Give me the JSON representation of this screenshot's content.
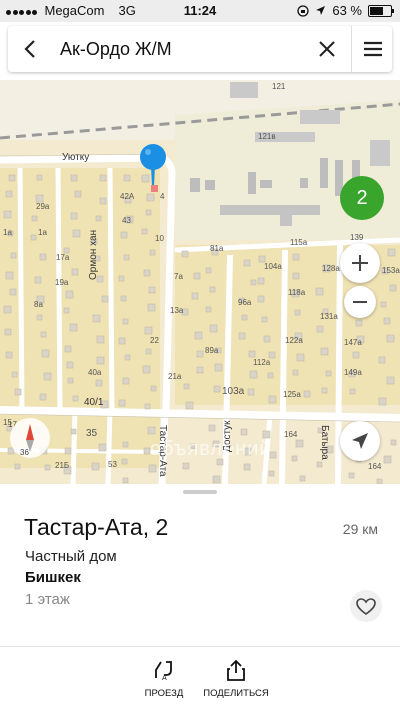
{
  "status_bar": {
    "carrier": "MegaCom",
    "network": "3G",
    "time": "11:24",
    "battery": "63 %",
    "battery_level": 0.63
  },
  "search": {
    "query": "Ак-Ордо Ж/М",
    "icons": [
      "back-arrow-icon",
      "clear-icon",
      "menu-icon"
    ]
  },
  "map": {
    "streets": [
      "Уютку",
      "Ормон хан",
      "Тастар-Ата",
      "Достук",
      "Батыра"
    ],
    "building_numbers": [
      "121",
      "121в",
      "42А",
      "4",
      "43",
      "10",
      "29а",
      "1а",
      "1а",
      "17а",
      "19а",
      "8а",
      "7а",
      "13а",
      "81а",
      "115а",
      "104а",
      "118а",
      "122а",
      "128а",
      "131а",
      "153а",
      "96а",
      "89а",
      "112а",
      "147а",
      "149а",
      "103а",
      "125а",
      "139",
      "22",
      "21а",
      "40а",
      "40/1",
      "35",
      "21Б",
      "53",
      "164",
      "164",
      "17",
      "15"
    ],
    "cluster_count": "2",
    "compass_label": "36",
    "watermark": "объявлений",
    "colors": {
      "land": "#f6ecd0",
      "road": "#ffffff",
      "blocks": "#efe2b3",
      "pin": "#1a8fe3",
      "cluster": "#3aa52d"
    }
  },
  "listing": {
    "title": "Тастар-Ата, 2",
    "distance": "29 км",
    "property_type": "Частный дом",
    "city": "Бишкек",
    "floors": "1 этаж"
  },
  "actions": {
    "route_label": "ПРОЕЗД",
    "share_label": "ПОДЕЛИТЬСЯ"
  }
}
